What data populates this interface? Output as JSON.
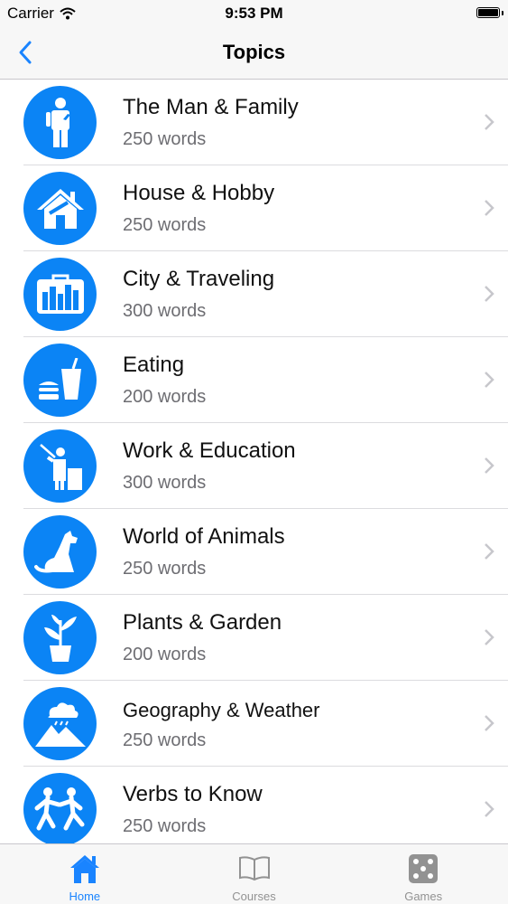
{
  "status_bar": {
    "carrier": "Carrier",
    "time": "9:53 PM"
  },
  "nav": {
    "title": "Topics"
  },
  "colors": {
    "accent": "#0b84f5",
    "tab_active": "#1a84ff",
    "tab_inactive": "#929292"
  },
  "topics": [
    {
      "title": "The Man & Family",
      "count": "250 words",
      "icon": "person-icon"
    },
    {
      "title": "House & Hobby",
      "count": "250 words",
      "icon": "house-icon"
    },
    {
      "title": "City & Traveling",
      "count": "300 words",
      "icon": "suitcase-city-icon"
    },
    {
      "title": "Eating",
      "count": "200 words",
      "icon": "food-drink-icon"
    },
    {
      "title": "Work & Education",
      "count": "300 words",
      "icon": "teacher-icon"
    },
    {
      "title": "World of Animals",
      "count": "250 words",
      "icon": "dog-icon"
    },
    {
      "title": "Plants & Garden",
      "count": "200 words",
      "icon": "plant-pot-icon"
    },
    {
      "title": "Geography & Weather",
      "count": "250 words",
      "icon": "mountain-cloud-icon"
    },
    {
      "title": "Verbs to Know",
      "count": "250 words",
      "icon": "running-people-icon"
    }
  ],
  "tabs": [
    {
      "label": "Home",
      "icon": "home-icon",
      "active": true
    },
    {
      "label": "Courses",
      "icon": "book-icon",
      "active": false
    },
    {
      "label": "Games",
      "icon": "dice-icon",
      "active": false
    }
  ]
}
